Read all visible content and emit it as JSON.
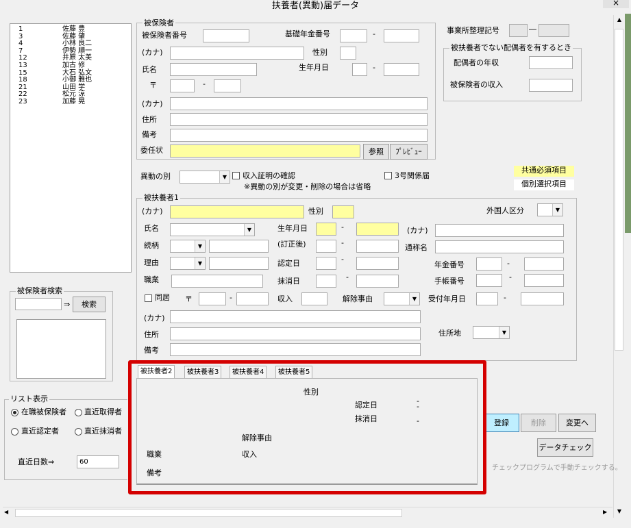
{
  "window": {
    "title": "扶養者(異動)届データ",
    "close_label": "×"
  },
  "list": {
    "rows": [
      {
        "no": "1",
        "name": "佐藤 豊"
      },
      {
        "no": "3",
        "name": "佐藤 肇"
      },
      {
        "no": "4",
        "name": "小林 良二"
      },
      {
        "no": "7",
        "name": "伊勢 順一"
      },
      {
        "no": "12",
        "name": "井原 太美"
      },
      {
        "no": "13",
        "name": "加古 修"
      },
      {
        "no": "15",
        "name": "大石 弘文"
      },
      {
        "no": "18",
        "name": "小御 雅也"
      },
      {
        "no": "21",
        "name": "山田 学"
      },
      {
        "no": "22",
        "name": "松元 涼"
      },
      {
        "no": "23",
        "name": "加藤 晃"
      }
    ]
  },
  "search": {
    "title": "被保険者検索",
    "arrow": "⇒",
    "button": "検索",
    "value": ""
  },
  "list_display": {
    "title": "リスト表示",
    "options": [
      "在職被保険者",
      "直近取得者",
      "直近認定者",
      "直近抹消者"
    ],
    "selected": "在職被保険者",
    "recent_days_label": "直近日数⇒",
    "recent_days_value": "60"
  },
  "insured": {
    "title": "被保険者",
    "number_label": "被保険者番号",
    "pension_label": "基礎年金番号",
    "dash": "-",
    "kana_label": "(カナ)",
    "gender_label": "性別",
    "name_label": "氏名",
    "birth_label": "生年月日",
    "zip_label": "〒",
    "address_kana_label": "(カナ)",
    "address_label": "住所",
    "remarks_label": "備考",
    "delegation_label": "委任状",
    "browse_button": "参照",
    "preview_button": "ﾌﾟﾚﾋﾞｭｰ"
  },
  "office": {
    "label": "事業所整理記号",
    "dash": "―"
  },
  "spouse": {
    "title": "被扶養者でない配偶者を有するとき",
    "annual_income_label": "配偶者の年収",
    "insured_income_label": "被保険者の収入"
  },
  "change": {
    "type_label": "異動の別",
    "income_check_label": "収入証明の確認",
    "no3_label": "3号関係届",
    "note": "※異動の別が変更・削除の場合は省略",
    "legend_required": "共通必須項目",
    "legend_optional": "個別選択項目"
  },
  "dependent1": {
    "title": "被扶養者1",
    "kana_label": "(カナ)",
    "gender_label": "性別",
    "foreign_label": "外国人区分",
    "name_label": "氏名",
    "birth_label": "生年月日",
    "kana2_label": "(カナ)",
    "relation_label": "続柄",
    "corrected_label": "(訂正後)",
    "alias_label": "通称名",
    "reason_label": "理由",
    "certified_label": "認定日",
    "pension_label": "年金番号",
    "job_label": "職業",
    "deleted_label": "抹消日",
    "handbook_label": "手帳番号",
    "cohabit_label": "同居",
    "zip_label": "〒",
    "income_label": "収入",
    "release_label": "解除事由",
    "received_label": "受付年月日",
    "address_kana_label": "(カナ)",
    "address_label": "住所",
    "residence_label": "住所地",
    "remarks_label": "備考",
    "dash": "-"
  },
  "tabs": {
    "items": [
      "被扶養者2",
      "被扶養者3",
      "被扶養者4",
      "被扶養者5"
    ],
    "active": "被扶養者2",
    "gender_label": "性別",
    "certified_label": "認定日",
    "deleted_label": "抹消日",
    "release_label": "解除事由",
    "job_label": "職業",
    "income_label": "収入",
    "remarks_label": "備考",
    "dash": "-"
  },
  "actions": {
    "register": "登録",
    "delete": "削除",
    "change": "変更へ",
    "data_check": "データチェック",
    "check_program_text": "チェックプログラムで手動チェックする。"
  },
  "colors": {
    "required_field": "#ffffa0",
    "register_button": "#bfefff",
    "highlight_border": "#d40000"
  }
}
